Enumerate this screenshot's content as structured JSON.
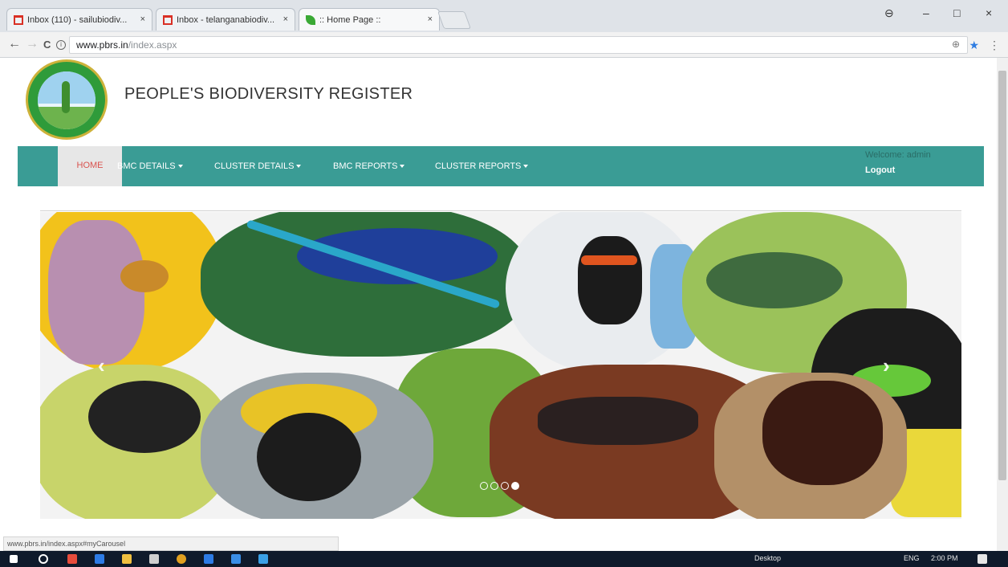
{
  "browser": {
    "tabs": [
      {
        "title": "Inbox (110) - sailubiodiv...",
        "icon": "gmail-icon"
      },
      {
        "title": "Inbox - telanganabiodiv...",
        "icon": "gmail-icon"
      },
      {
        "title": ":: Home Page ::",
        "icon": "leaf-icon"
      }
    ],
    "tab_close": "×",
    "window_controls": {
      "account": "⊖",
      "minimize": "–",
      "maximize": "□",
      "close": "×"
    },
    "address": {
      "host": "www.pbrs.in",
      "path": "/index.aspx"
    },
    "nav": {
      "back": "←",
      "forward": "→",
      "reload": "C",
      "info": "i"
    },
    "zoom_icon": "⊕",
    "star": "★",
    "menu": "⋮"
  },
  "site": {
    "title": "PEOPLE'S BIODIVERSITY REGISTER",
    "nav": {
      "home": "HOME",
      "bmc_details": "BMC DETAILS",
      "cluster_details": "CLUSTER DETAILS",
      "bmc_reports": "BMC REPORTS",
      "cluster_reports": "CLUSTER REPORTS"
    },
    "welcome": "Welcome: admin",
    "logout": "Logout",
    "carousel": {
      "prev": "‹",
      "next": "›"
    }
  },
  "status_url": "www.pbrs.in/index.aspx#myCarousel",
  "taskbar": {
    "desktop": "Desktop",
    "lang": "ENG",
    "time": "2:00 PM"
  },
  "colors": {
    "navbar": "#3a9c95",
    "home_text": "#d9534f"
  }
}
